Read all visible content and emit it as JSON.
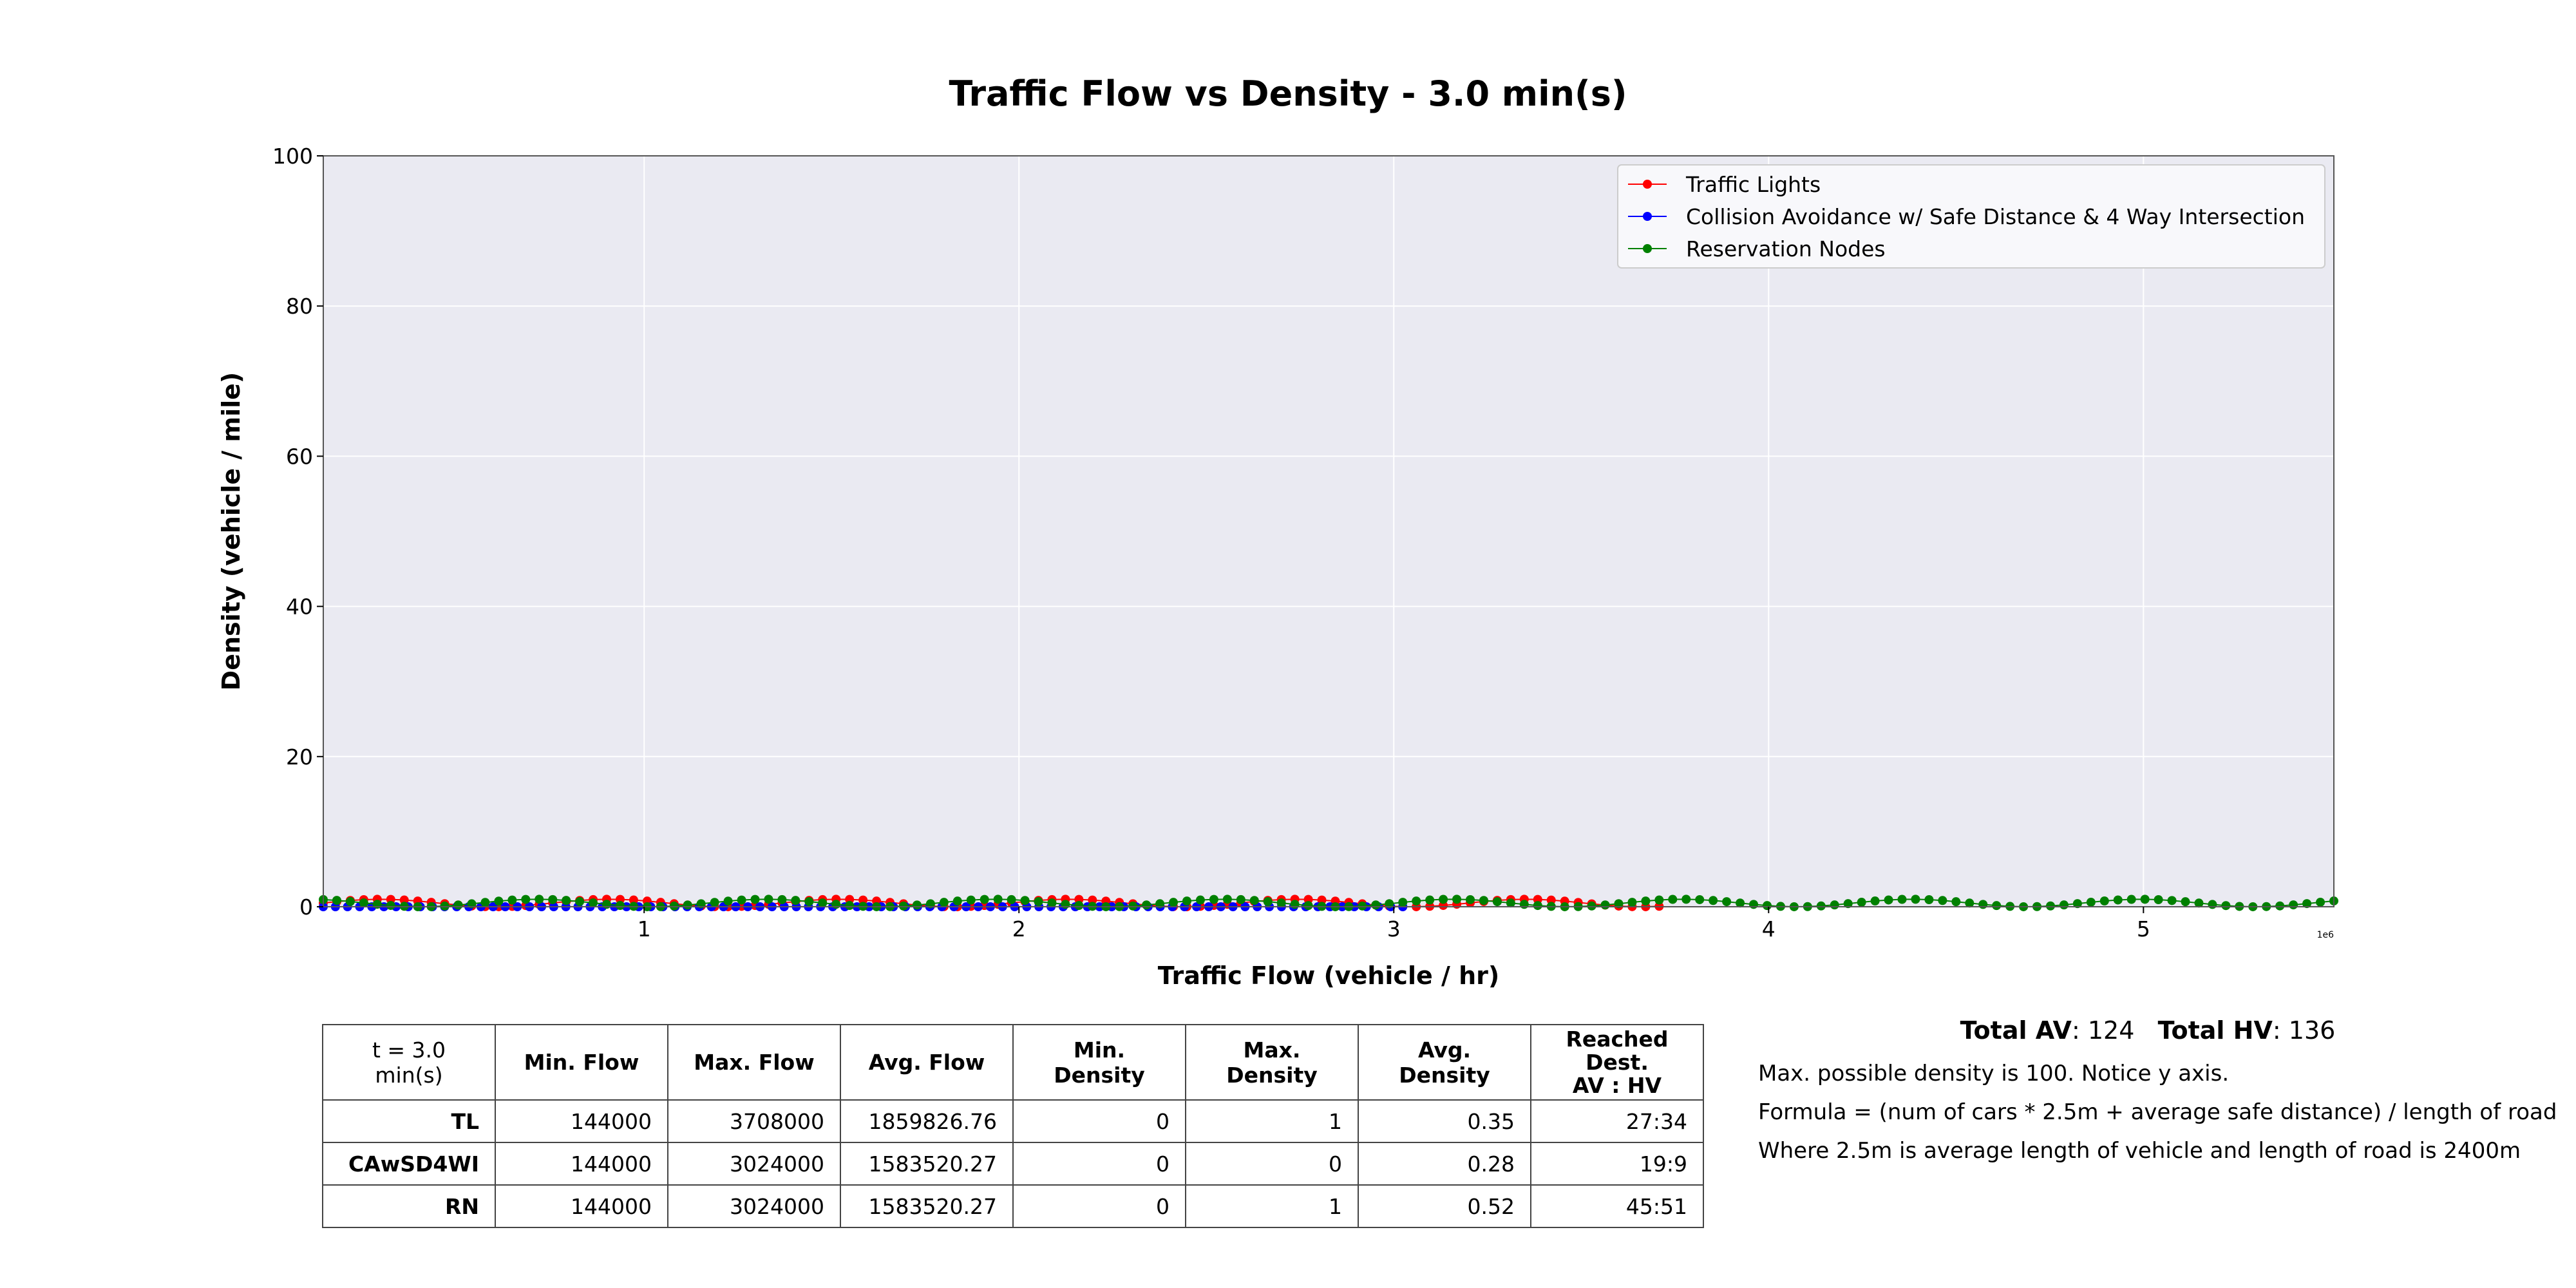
{
  "title": "Traffic Flow vs Density - 3.0 min(s)",
  "colors": {
    "tl": "#ff0000",
    "ca": "#0000ff",
    "rn": "#008000",
    "plot_bg": "#eaeaf2"
  },
  "chart_data": {
    "type": "line",
    "title": "Traffic Flow vs Density - 3.0 min(s)",
    "xlabel": "Traffic Flow (vehicle / hr)",
    "ylabel": "Density (vehicle / mile)",
    "x_scale_label": "1e6",
    "xlim": [
      144000,
      5508000
    ],
    "ylim": [
      0,
      100
    ],
    "x_ticks": [
      1000000,
      2000000,
      3000000,
      4000000,
      5000000
    ],
    "x_tick_labels": [
      "1",
      "2",
      "3",
      "4",
      "5"
    ],
    "y_ticks": [
      0,
      20,
      40,
      60,
      80,
      100
    ],
    "y_tick_labels": [
      "0",
      "20",
      "40",
      "60",
      "80",
      "100"
    ],
    "grid": true,
    "legend_position": "top-right",
    "series": [
      {
        "name": "Traffic Lights",
        "color": "#ff0000",
        "x_range": [
          144000,
          3708000
        ],
        "count": 100,
        "y_range": [
          0,
          1
        ],
        "avg": 0.35
      },
      {
        "name": "Collision Avoidance w/ Safe Distance & 4 Way Intersection",
        "color": "#0000ff",
        "x_range": [
          144000,
          3024000
        ],
        "count": 90,
        "y_range": [
          0,
          0
        ],
        "avg": 0.28
      },
      {
        "name": "Reservation Nodes",
        "color": "#008000",
        "x_range": [
          144000,
          5508000
        ],
        "count": 150,
        "y_range": [
          0,
          1
        ],
        "avg": 0.52
      }
    ]
  },
  "table": {
    "corner": "t = 3.0 min(s)",
    "headers": [
      "Min. Flow",
      "Max. Flow",
      "Avg. Flow",
      "Min. Density",
      "Max. Density",
      "Avg. Density",
      "Reached Dest.\nAV : HV"
    ],
    "rows": [
      {
        "label": "TL",
        "cells": [
          "144000",
          "3708000",
          "1859826.76",
          "0",
          "1",
          "0.35",
          "27:34"
        ]
      },
      {
        "label": "CAwSD4WI",
        "cells": [
          "144000",
          "3024000",
          "1583520.27",
          "0",
          "0",
          "0.28",
          "19:9"
        ]
      },
      {
        "label": "RN",
        "cells": [
          "144000",
          "3024000",
          "1583520.27",
          "0",
          "1",
          "0.52",
          "45:51"
        ]
      }
    ]
  },
  "totals": {
    "av_label": "Total AV",
    "av_value": ": 124",
    "hv_label": "Total HV",
    "hv_value": ": 136"
  },
  "notes": [
    "Max. possible density is 100. Notice y axis.",
    "Formula = (num of cars * 2.5m + average safe distance) / length of road",
    "Where 2.5m is average length of vehicle and length of road is 2400m"
  ]
}
